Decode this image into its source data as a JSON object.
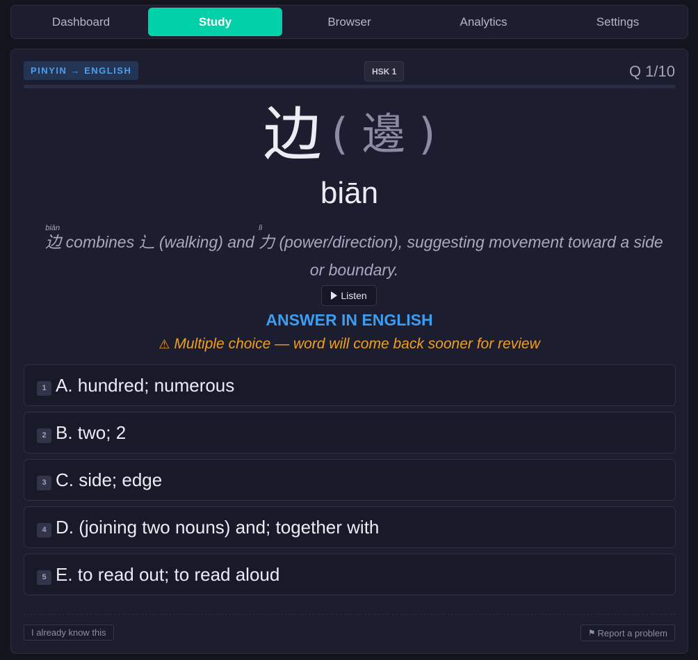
{
  "nav": {
    "tabs": [
      {
        "label": "Dashboard",
        "active": false
      },
      {
        "label": "Study",
        "active": true
      },
      {
        "label": "Browser",
        "active": false
      },
      {
        "label": "Analytics",
        "active": false
      },
      {
        "label": "Settings",
        "active": false
      }
    ]
  },
  "card": {
    "mode_badge": "PINYIN → ENGLISH",
    "level_badge": "HSK 1",
    "question_counter": "Q 1/10",
    "progress_fraction": 0.0
  },
  "word": {
    "simplified": "边",
    "traditional": "( 邊 )",
    "pinyin": "biān"
  },
  "mnemonic": {
    "char1": "边",
    "char1_pinyin": "biān",
    "text1": " combines ",
    "radical": "辶",
    "text2": " (walking) and ",
    "char2": "力",
    "char2_pinyin": "lì",
    "text3": " (power/direction), suggesting movement toward a side or boundary."
  },
  "listen": {
    "label": "Listen",
    "icon": "play-icon"
  },
  "answer_heading": "ANSWER IN ENGLISH",
  "warning": {
    "icon": "⚠",
    "text": "Multiple choice — word will come back sooner for review"
  },
  "options": [
    {
      "key": "1",
      "text": "A. hundred; numerous"
    },
    {
      "key": "2",
      "text": "B. two; 2"
    },
    {
      "key": "3",
      "text": "C. side; edge"
    },
    {
      "key": "4",
      "text": "D. (joining two nouns) and; together with"
    },
    {
      "key": "5",
      "text": "E. to read out; to read aloud"
    }
  ],
  "footer": {
    "already_know_label": "I already know this",
    "report_icon": "⚑",
    "report_label": "Report a problem"
  },
  "colors": {
    "accent": "#00d1a8",
    "heading_blue": "#3d9df2",
    "warning_orange": "#f0a020",
    "background": "#14141f",
    "panel": "#1c1d2e"
  }
}
